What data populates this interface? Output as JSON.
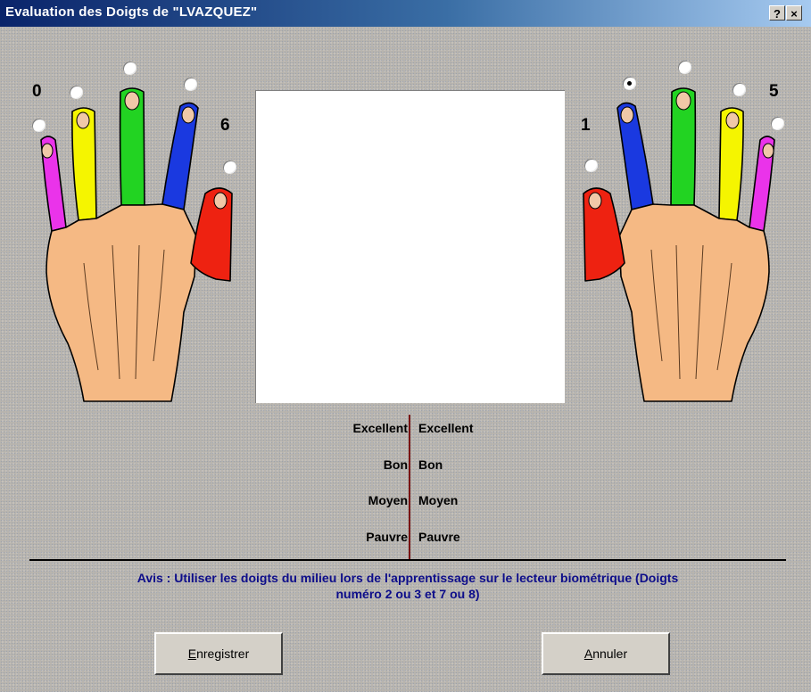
{
  "window": {
    "title": "Evaluation des Doigts de \"LVAZQUEZ\"",
    "help_label": "?",
    "close_label": "×"
  },
  "left_hand": {
    "number_pinky": "0",
    "number_thumb": "6",
    "selected_finger": null
  },
  "right_hand": {
    "number_thumb": "1",
    "number_pinky": "5",
    "selected_finger": "index"
  },
  "finger_colors": {
    "thumb": "#ee2211",
    "index": "#1a39e0",
    "middle": "#22d322",
    "ring": "#f5f500",
    "pinky": "#ea33ea",
    "skin": "#f5b984"
  },
  "quality": {
    "left": [
      "Excellent",
      "Bon",
      "Moyen",
      "Pauvre"
    ],
    "right": [
      "Excellent",
      "Bon",
      "Moyen",
      "Pauvre"
    ]
  },
  "notice": {
    "line1": "Avis : Utiliser les doigts du milieu lors de l'apprentissage sur le lecteur biométrique (Doigts",
    "line2": "numéro 2 ou 3 et 7 ou 8)"
  },
  "buttons": {
    "save": {
      "accel": "E",
      "rest": "nregistrer"
    },
    "cancel": {
      "accel": "A",
      "rest": "nnuler"
    }
  }
}
